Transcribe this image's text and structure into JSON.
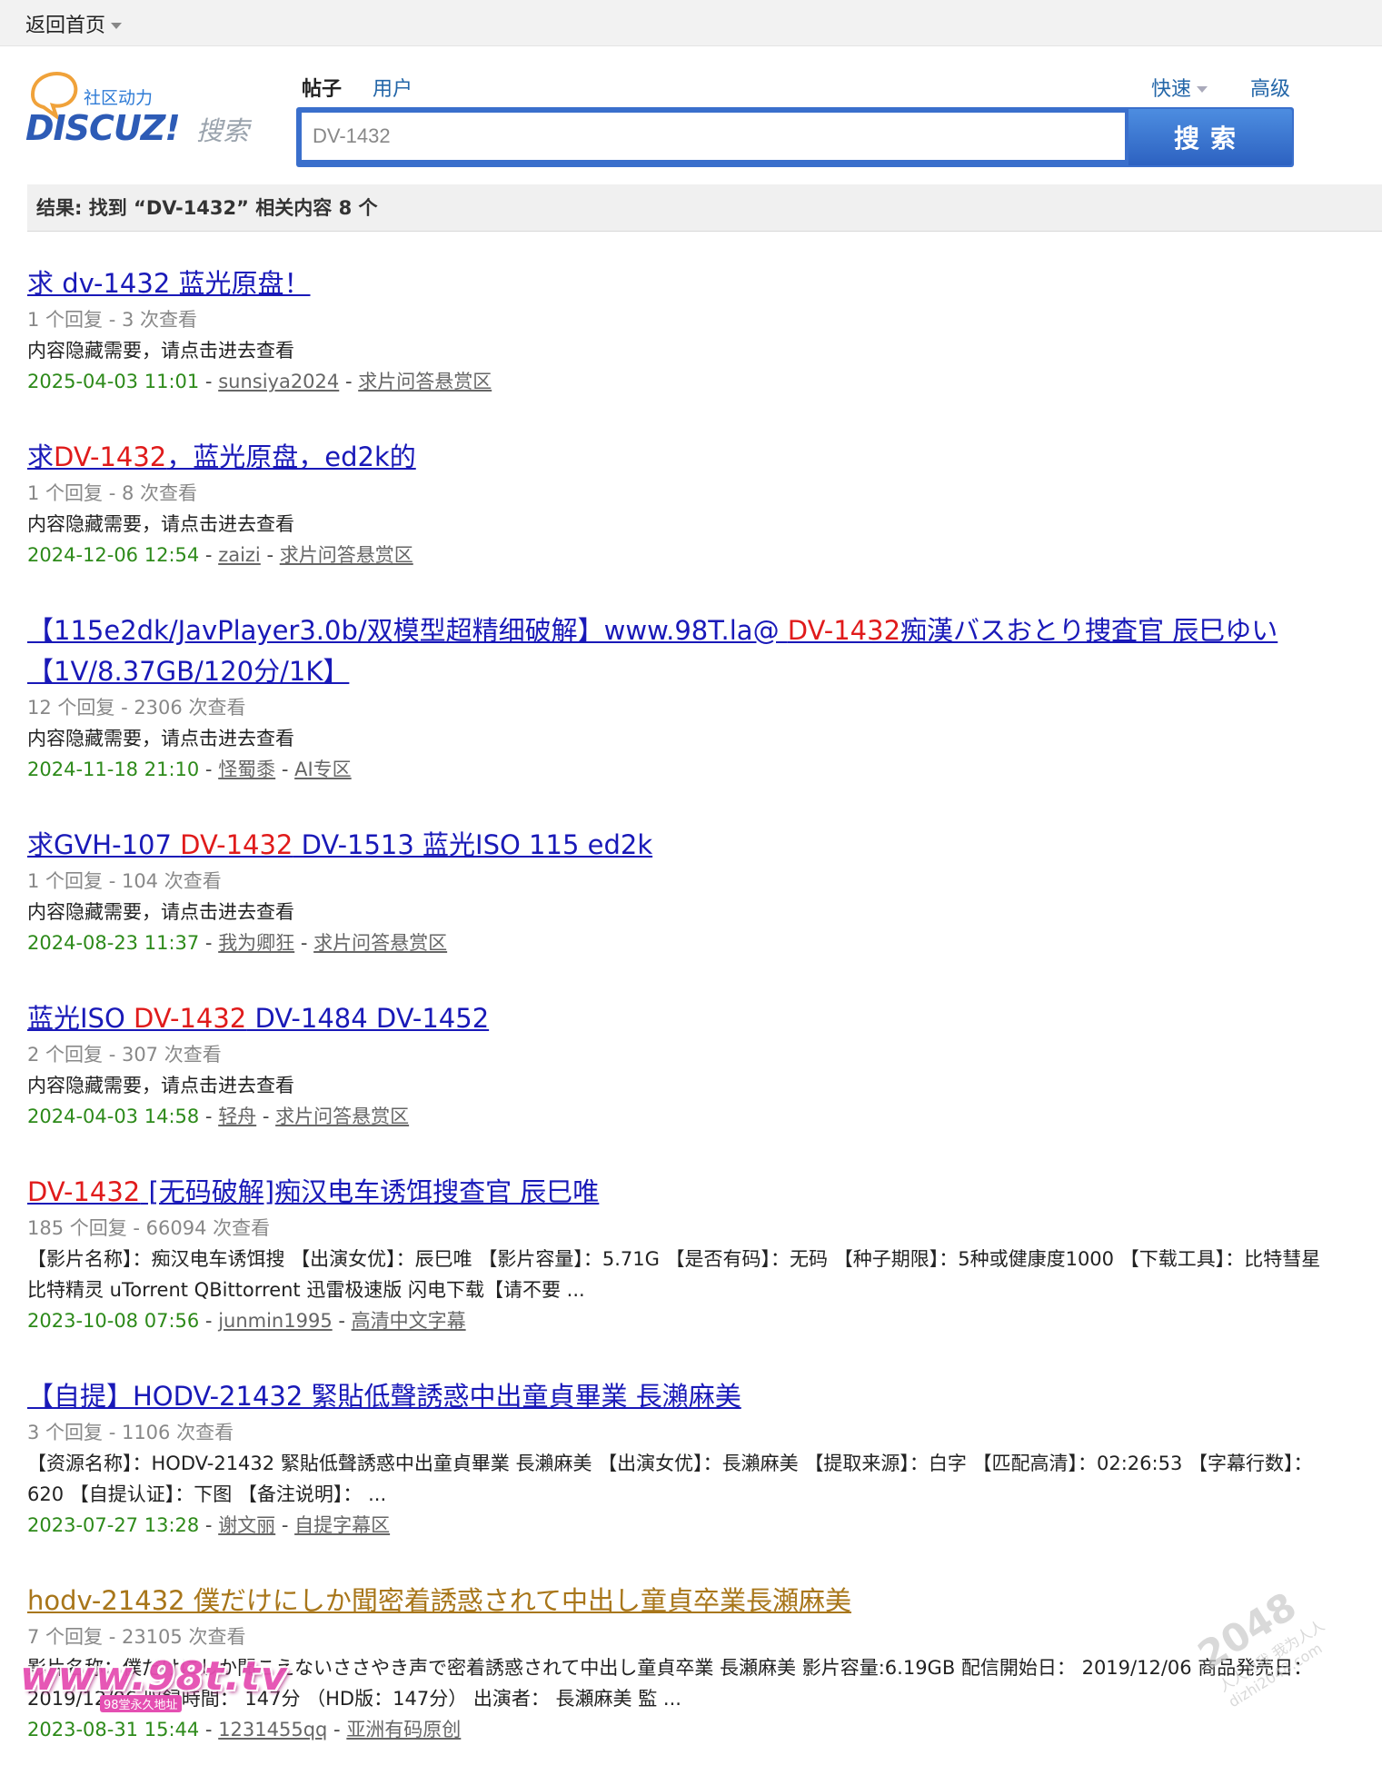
{
  "topbar": {
    "home_label": "返回首页"
  },
  "logo": {
    "brand": "DISCUZ!",
    "brand_cn": "社区动力",
    "search_cn": "搜索"
  },
  "search": {
    "tabs": [
      {
        "label": "帖子",
        "active": true
      },
      {
        "label": "用户",
        "active": false
      }
    ],
    "quick_label": "快速",
    "advanced_label": "高级",
    "query": "DV-1432",
    "button_label": "搜索"
  },
  "summary": "结果: 找到 “DV-1432” 相关内容 8 个",
  "results": [
    {
      "title_parts": [
        {
          "t": "求 dv-1432 蓝光原盘！ ",
          "hl": false
        }
      ],
      "visited": false,
      "stats": "1 个回复 - 3 次查看",
      "excerpt": "内容隐藏需要，请点击进去查看",
      "date": "2025-04-03 11:01",
      "author": "sunsiya2024",
      "forum": "求片问答悬赏区"
    },
    {
      "title_parts": [
        {
          "t": "求",
          "hl": false
        },
        {
          "t": "DV-1432",
          "hl": true
        },
        {
          "t": "，蓝光原盘，ed2k的",
          "hl": false
        }
      ],
      "visited": false,
      "stats": "1 个回复 - 8 次查看",
      "excerpt": "内容隐藏需要，请点击进去查看",
      "date": "2024-12-06 12:54",
      "author": "zaizi",
      "forum": "求片问答悬赏区"
    },
    {
      "title_parts": [
        {
          "t": "【115e2dk/JavPlayer3.0b/双模型超精细破解】www.98T.la@ ",
          "hl": false
        },
        {
          "t": "DV-1432",
          "hl": true
        },
        {
          "t": "痴漢バスおとり捜査官 辰巳ゆい【1V/8.37GB/120分/1K】",
          "hl": false
        }
      ],
      "visited": false,
      "stats": "12 个回复 - 2306 次查看",
      "excerpt": "内容隐藏需要，请点击进去查看",
      "date": "2024-11-18 21:10",
      "author": "怪蜀黍",
      "forum": "AI专区"
    },
    {
      "title_parts": [
        {
          "t": "求GVH-107 ",
          "hl": false
        },
        {
          "t": "DV-1432",
          "hl": true
        },
        {
          "t": " DV-1513 蓝光ISO 115 ed2k",
          "hl": false
        }
      ],
      "visited": false,
      "stats": "1 个回复 - 104 次查看",
      "excerpt": "内容隐藏需要，请点击进去查看",
      "date": "2024-08-23 11:37",
      "author": "我为卿狂",
      "forum": "求片问答悬赏区"
    },
    {
      "title_parts": [
        {
          "t": "蓝光ISO ",
          "hl": false
        },
        {
          "t": "DV-1432",
          "hl": true
        },
        {
          "t": " DV-1484 DV-1452",
          "hl": false
        }
      ],
      "visited": false,
      "stats": "2 个回复 - 307 次查看",
      "excerpt": "内容隐藏需要，请点击进去查看",
      "date": "2024-04-03 14:58",
      "author": "轻舟",
      "forum": "求片问答悬赏区"
    },
    {
      "title_parts": [
        {
          "t": "DV-1432",
          "hl": true
        },
        {
          "t": " [无码破解]痴汉电车诱饵搜查官 辰巳唯",
          "hl": false
        }
      ],
      "visited": false,
      "stats": "185 个回复 - 66094 次查看",
      "excerpt": "【影片名称】：痴汉电车诱饵搜 【出演女优】：辰巳唯 【影片容量】：5.71G 【是否有码】：无码 【种子期限】：5种或健康度1000 【下载工具】：比特彗星 比特精灵 uTorrent QBittorrent 迅雷极速版 闪电下载【请不要 ...",
      "date": "2023-10-08 07:56",
      "author": "junmin1995",
      "forum": "高清中文字幕"
    },
    {
      "title_parts": [
        {
          "t": "【自提】HODV-21432 緊貼低聲誘惑中出童貞畢業 長瀨麻美",
          "hl": false
        }
      ],
      "visited": false,
      "stats": "3 个回复 - 1106 次查看",
      "excerpt": "【资源名称】：HODV-21432 緊貼低聲誘惑中出童貞畢業 長瀨麻美 【出演女优】：長瀨麻美 【提取来源】：白字 【匹配高清】：02:26:53 【字幕行数】：620 【自提认证】：下图 【备注说明】： ...",
      "date": "2023-07-27 13:28",
      "author": "谢文丽",
      "forum": "自提字幕区"
    },
    {
      "title_parts": [
        {
          "t": "hodv-21432 僕だけにしか聞密着誘惑されて中出し童貞卒業長瀬麻美",
          "hl": false
        }
      ],
      "visited": true,
      "stats": "7 个回复 - 23105 次查看",
      "excerpt": "影片名称：僕だけにしか聞こえないささやき声で密着誘惑されて中出し童貞卒業 長瀬麻美 影片容量:6.19GB 配信開始日： 2019/12/06 商品発売日： 2019/12/06 収録時間： 147分 （HD版：147分） 出演者： 長瀬麻美 監 ...",
      "date": "2023-08-31 15:44",
      "author": "1231455qq",
      "forum": "亚洲有码原创"
    }
  ],
  "watermarks": {
    "left": "www.98t.tv",
    "left_sub": "98堂永久地址",
    "right_big": "2048",
    "right_small": "人人为我 我为人人 dizhi2048.com"
  },
  "colors": {
    "link": "#1919b8",
    "visited_link": "#a8761a",
    "highlight": "#e01b1b",
    "meta_date": "#2d8a1a",
    "search_blue": "#3a6fcc"
  }
}
